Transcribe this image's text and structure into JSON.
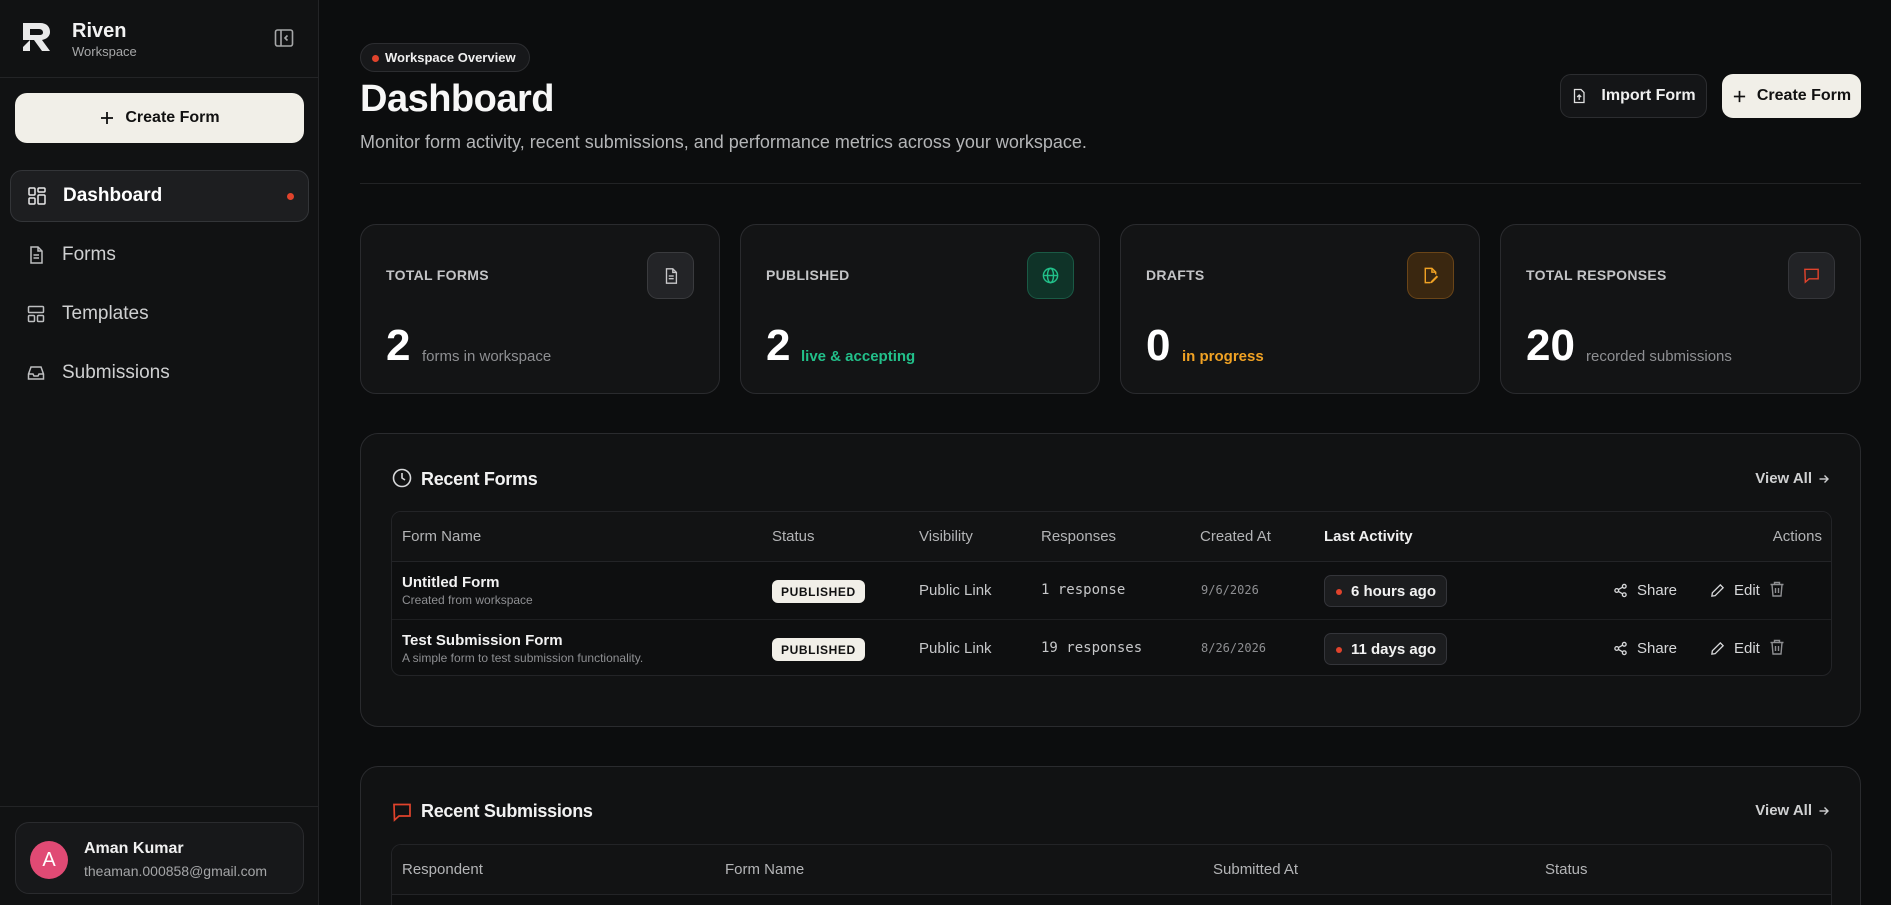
{
  "brand": {
    "name": "Riven",
    "subtitle": "Workspace"
  },
  "sidebar": {
    "create_label": "Create Form",
    "items": [
      {
        "label": "Dashboard",
        "icon": "dashboard-icon",
        "active": true
      },
      {
        "label": "Forms",
        "icon": "document-icon"
      },
      {
        "label": "Templates",
        "icon": "template-icon"
      },
      {
        "label": "Submissions",
        "icon": "inbox-icon"
      }
    ]
  },
  "user": {
    "initial": "A",
    "name": "Aman Kumar",
    "email": "theaman.000858@gmail.com",
    "avatar_color": "#e04a74"
  },
  "header": {
    "pill": "Workspace Overview",
    "title": "Dashboard",
    "subtitle": "Monitor form activity, recent submissions, and performance metrics across your workspace.",
    "import_label": "Import Form",
    "create_label": "Create Form"
  },
  "stats": [
    {
      "label": "TOTAL FORMS",
      "value": "2",
      "desc": "forms in workspace",
      "icon": "document-icon",
      "desc_color": "#8e8f92"
    },
    {
      "label": "PUBLISHED",
      "value": "2",
      "desc": "live & accepting",
      "icon": "globe-icon",
      "desc_color": "#22c08a"
    },
    {
      "label": "DRAFTS",
      "value": "0",
      "desc": "in progress",
      "icon": "pencil-file-icon",
      "desc_color": "#f0a224"
    },
    {
      "label": "TOTAL RESPONSES",
      "value": "20",
      "desc": "recorded submissions",
      "icon": "message-icon",
      "desc_color": "#8e8f92"
    }
  ],
  "recent_forms": {
    "title": "Recent Forms",
    "view_all": "View All",
    "columns": [
      "Form Name",
      "Status",
      "Visibility",
      "Responses",
      "Created At",
      "Last Activity",
      "Actions"
    ],
    "rows": [
      {
        "name": "Untitled Form",
        "desc": "Created from workspace",
        "status": "PUBLISHED",
        "visibility": "Public Link",
        "responses": "1 response",
        "created": "9/6/2026",
        "activity": "6 hours ago"
      },
      {
        "name": "Test Submission Form",
        "desc": "A simple form to test submission functionality.",
        "status": "PUBLISHED",
        "visibility": "Public Link",
        "responses": "19 responses",
        "created": "8/26/2026",
        "activity": "11 days ago"
      }
    ],
    "share_label": "Share",
    "edit_label": "Edit"
  },
  "recent_submissions": {
    "title": "Recent Submissions",
    "view_all": "View All",
    "columns": [
      "Respondent",
      "Form Name",
      "Submitted At",
      "Status"
    ]
  },
  "colors": {
    "accent": "#e0432c",
    "success": "#22c08a",
    "warning": "#f0a224",
    "background": "#0c0d0e"
  }
}
